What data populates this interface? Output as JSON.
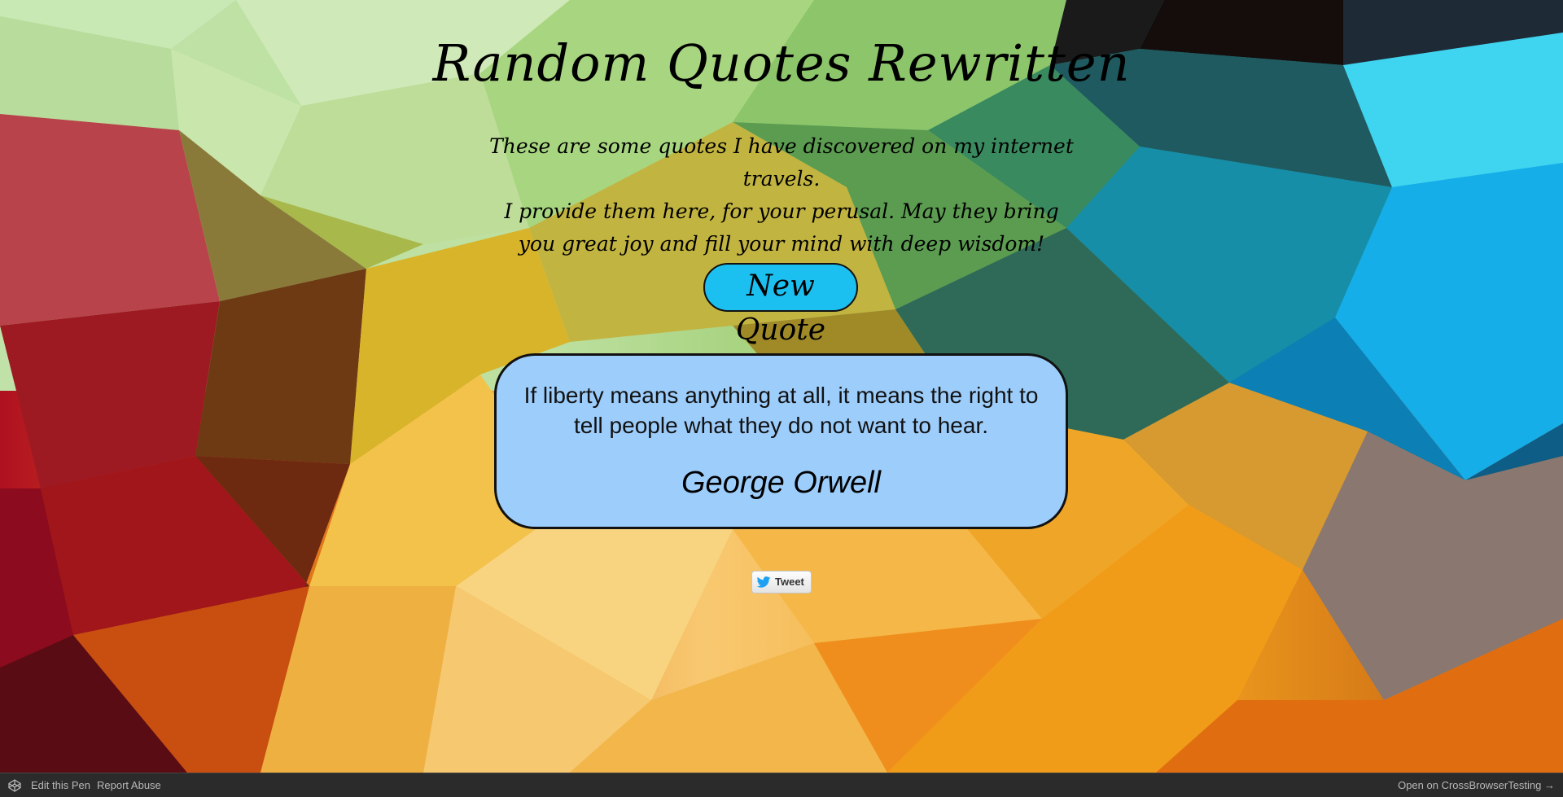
{
  "page": {
    "title": "Random Quotes Rewritten",
    "intro_lines": [
      "These are some quotes I have discovered on my internet travels.",
      "I provide them here, for your perusal. May they bring",
      "you great joy and fill your mind with deep wisdom!"
    ]
  },
  "controls": {
    "new_quote_label": "New Quote",
    "tweet_label": "Tweet"
  },
  "quote": {
    "text": "If liberty means anything at all, it means the right to tell people what they do not want to hear.",
    "author": "George Orwell"
  },
  "footer": {
    "edit_label": "Edit this Pen",
    "report_label": "Report Abuse",
    "open_label": "Open on CrossBrowserTesting →"
  },
  "colors": {
    "new_quote_bg": "#1cc0f0",
    "quote_box_bg": "#9dcdfb",
    "footer_bg": "#2b2b2b",
    "twitter_blue": "#1da1f2"
  },
  "icons": {
    "tweet": "twitter-bird-icon",
    "footer": "codepen-logo-icon"
  }
}
